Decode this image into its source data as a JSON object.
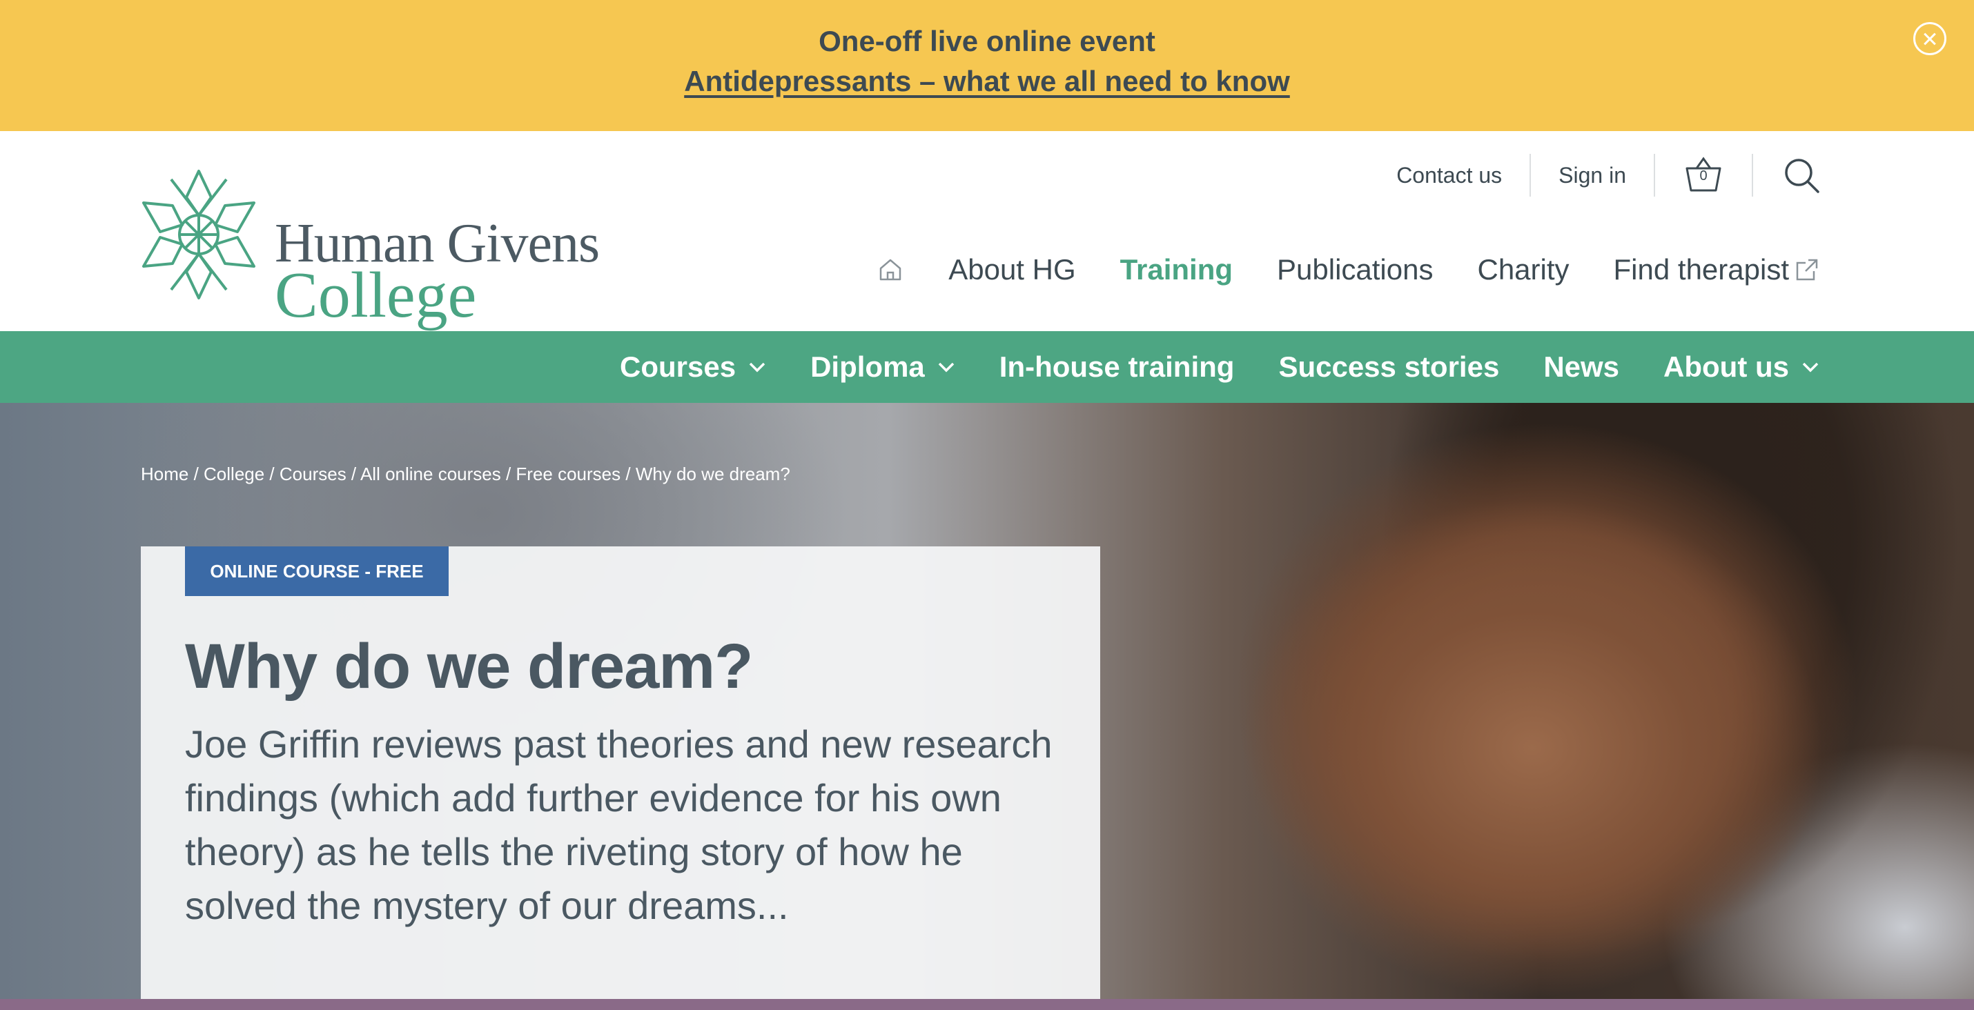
{
  "banner": {
    "headline": "One-off  live online event",
    "link": "Antidepressants – what we all need to know"
  },
  "logo": {
    "line1": "Human Givens",
    "line2": "College"
  },
  "utility_nav": {
    "contact": "Contact us",
    "sign_in": "Sign in",
    "basket_count": "0"
  },
  "main_nav": {
    "items": [
      {
        "label": "About HG"
      },
      {
        "label": "Training"
      },
      {
        "label": "Publications"
      },
      {
        "label": "Charity"
      },
      {
        "label": "Find therapist"
      }
    ]
  },
  "sub_nav": {
    "items": [
      {
        "label": "Courses"
      },
      {
        "label": "Diploma"
      },
      {
        "label": "In-house training"
      },
      {
        "label": "Success stories"
      },
      {
        "label": "News"
      },
      {
        "label": "About us"
      }
    ]
  },
  "breadcrumb": {
    "items": [
      "Home",
      "College",
      "Courses",
      "All online courses",
      "Free courses",
      "Why do we dream?"
    ],
    "separator": " / "
  },
  "hero": {
    "badge": "ONLINE COURSE - FREE",
    "title": "Why do we dream?",
    "description": "Joe Griffin reviews past theories and new research findings (which add further evidence for his own theory) as he tells the riveting story of how he solved the mystery of our dreams..."
  },
  "colors": {
    "banner": "#f6c751",
    "brand_green": "#4da683",
    "badge_blue": "#3b6aa6",
    "text_dark": "#3d4a52"
  },
  "icons": {
    "close": "close-icon",
    "basket": "basket-icon",
    "search": "search-icon",
    "home": "home-icon",
    "external": "external-link-icon",
    "chevron": "chevron-down-icon"
  }
}
